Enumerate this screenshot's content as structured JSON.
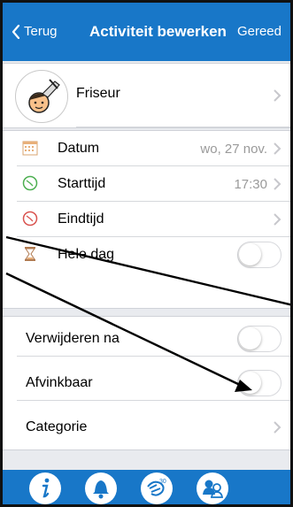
{
  "nav": {
    "back_label": "Terug",
    "title": "Activiteit bewerken",
    "done_label": "Gereed"
  },
  "activity": {
    "name": "Friseur",
    "avatar_icon": "hairdresser-icon"
  },
  "details": {
    "date_label": "Datum",
    "date_value": "wo, 27 nov.",
    "start_label": "Starttijd",
    "start_value": "17:30",
    "end_label": "Eindtijd",
    "allday_label": "Hele dag",
    "allday_on": false
  },
  "options": {
    "delete_after_label": "Verwijderen na",
    "delete_after_on": false,
    "checkable_label": "Afvinkbaar",
    "checkable_on": false,
    "category_label": "Categorie"
  },
  "toolbar": {
    "icons": [
      "info-icon",
      "bell-icon",
      "timer-icon",
      "people-icon"
    ],
    "timer_badge": "30"
  },
  "colors": {
    "accent": "#1877c8",
    "clock_green": "#4caf50",
    "clock_red": "#d9534f"
  }
}
